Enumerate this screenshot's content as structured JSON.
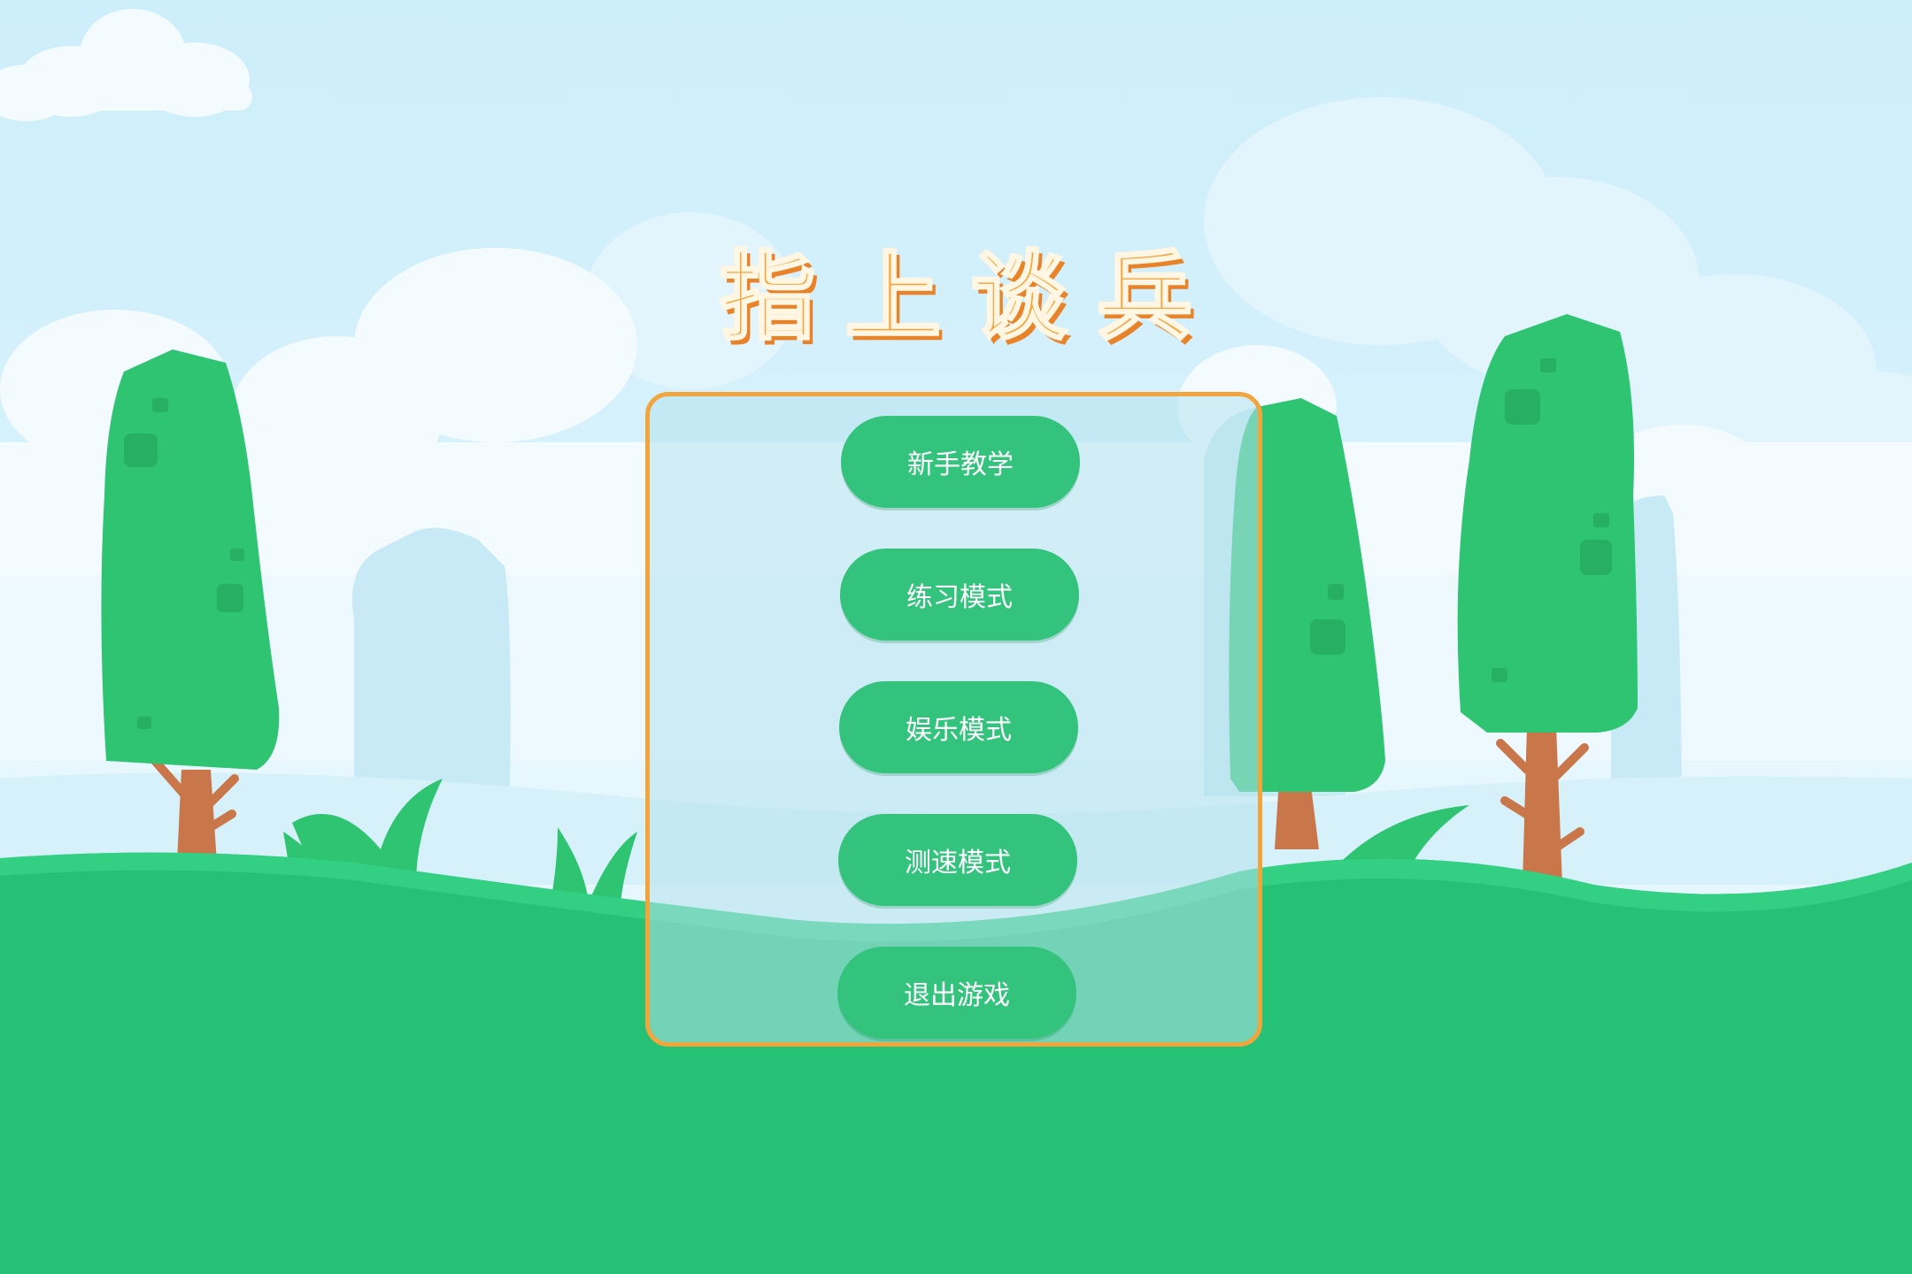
{
  "title": "指上谈兵",
  "menu": {
    "items": [
      {
        "id": "tutorial",
        "label": "新手教学"
      },
      {
        "id": "practice",
        "label": "练习模式"
      },
      {
        "id": "entertainment",
        "label": "娱乐模式"
      },
      {
        "id": "speed-test",
        "label": "测速模式"
      },
      {
        "id": "exit",
        "label": "退出游戏"
      }
    ]
  },
  "colors": {
    "sky": "#cdeefb",
    "grass": "#25c174",
    "tree": "#2ec472",
    "trunk": "#c9774a",
    "title": "#f7a33a",
    "panel_border": "#f2a43d",
    "button": "#34c37d"
  }
}
